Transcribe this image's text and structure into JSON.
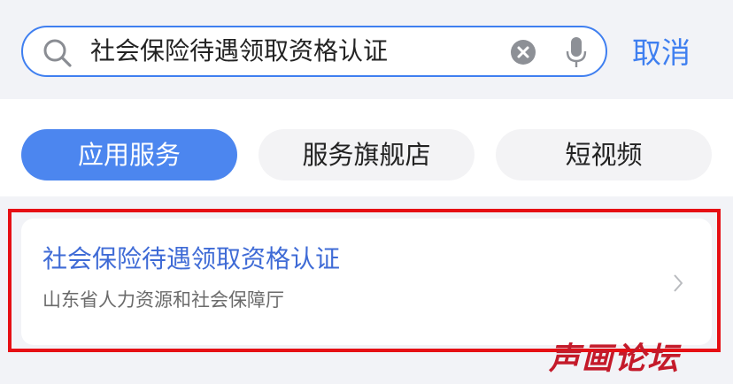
{
  "search": {
    "query": "社会保险待遇领取资格认证",
    "cancel_label": "取消"
  },
  "tabs": [
    {
      "label": "应用服务",
      "active": true
    },
    {
      "label": "服务旗舰店",
      "active": false
    },
    {
      "label": "短视频",
      "active": false
    }
  ],
  "result": {
    "title": "社会保险待遇领取资格认证",
    "subtitle": "山东省人力资源和社会保障厅"
  },
  "watermark": {
    "text": "声画论坛"
  },
  "colors": {
    "accent": "#3f7ff0",
    "tab_active_bg": "#4c86ef",
    "highlight": "#e60f14",
    "watermark": "#c41a2a"
  },
  "icons": [
    "search-icon",
    "clear-icon",
    "microphone-icon",
    "chevron-right-icon"
  ]
}
